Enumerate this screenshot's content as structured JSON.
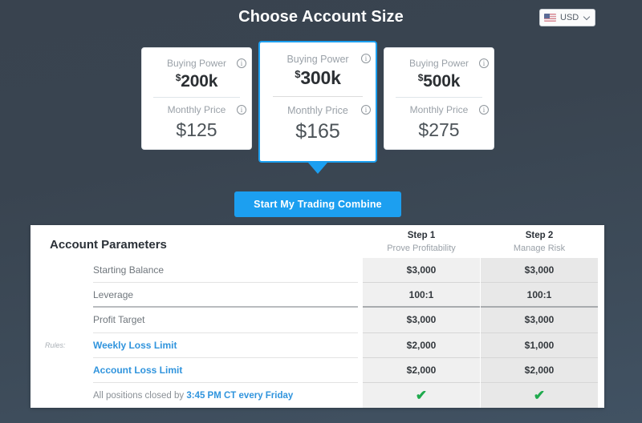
{
  "header": {
    "title": "Choose Account Size",
    "currency": {
      "value": "USD",
      "flag_icon": "us-flag-icon",
      "chevron_icon": "chevron-down-icon"
    }
  },
  "plans": [
    {
      "buying_power_label": "Buying Power",
      "currency_symbol": "$",
      "buying_power_value": "200k",
      "monthly_price_label": "Monthly Price",
      "monthly_price_value": "$125",
      "selected": false,
      "info_icon": "info-icon"
    },
    {
      "buying_power_label": "Buying Power",
      "currency_symbol": "$",
      "buying_power_value": "300k",
      "monthly_price_label": "Monthly Price",
      "monthly_price_value": "$165",
      "selected": true,
      "info_icon": "info-icon"
    },
    {
      "buying_power_label": "Buying Power",
      "currency_symbol": "$",
      "buying_power_value": "500k",
      "monthly_price_label": "Monthly Price",
      "monthly_price_value": "$275",
      "selected": false,
      "info_icon": "info-icon"
    }
  ],
  "cta": {
    "label": "Start My Trading Combine"
  },
  "parameters": {
    "title": "Account Parameters",
    "rules_label": "Rules:",
    "steps": [
      {
        "title": "Step 1",
        "subtitle": "Prove Profitability"
      },
      {
        "title": "Step 2",
        "subtitle": "Manage Risk"
      }
    ],
    "rows": [
      {
        "label": "Starting Balance",
        "is_link": false,
        "step1": "$3,000",
        "step2": "$3,000",
        "divider": "thin"
      },
      {
        "label": "Leverage",
        "is_link": false,
        "step1": "100:1",
        "step2": "100:1",
        "divider": "thick"
      },
      {
        "label": "Profit Target",
        "is_link": false,
        "step1": "$3,000",
        "step2": "$3,000",
        "divider": "thin"
      },
      {
        "label": "Weekly Loss Limit",
        "is_link": true,
        "step1": "$2,000",
        "step2": "$1,000",
        "divider": "thin"
      },
      {
        "label": "Account Loss Limit",
        "is_link": true,
        "step1": "$2,000",
        "step2": "$2,000",
        "divider": "thin"
      }
    ],
    "closing_row": {
      "text_before": "All positions closed by ",
      "highlight": "3:45 PM CT every Friday",
      "step1_icon": "check-icon",
      "step2_icon": "check-icon",
      "check_glyph": "✔"
    }
  },
  "colors": {
    "background_top": "#39434f",
    "background_bottom": "#415263",
    "accent_blue": "#1c9ff0",
    "link_blue": "#3094dd",
    "check_green": "#1faa4d",
    "step1_column": "#f0f0f0",
    "step2_column": "#e8e8e8"
  }
}
